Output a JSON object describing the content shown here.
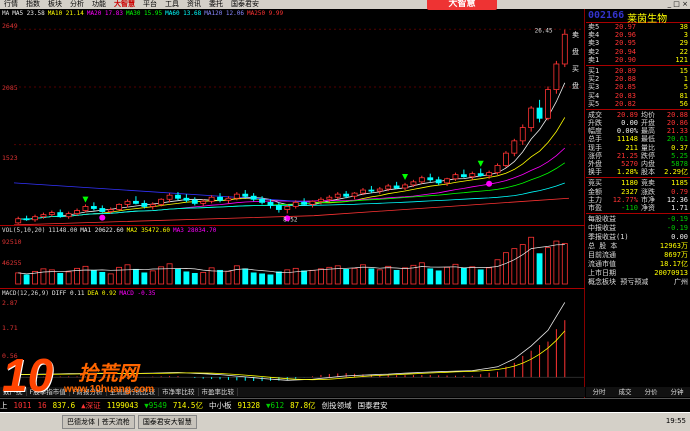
{
  "menu": {
    "items": [
      "行情",
      "指数",
      "板块",
      "分析",
      "功能",
      "大智慧",
      "平台",
      "工具",
      "资讯",
      "委托",
      "国泰君安"
    ],
    "logo": "大智慧"
  },
  "stock": {
    "code": "002166",
    "name": "莱茵生物"
  },
  "main_chart": {
    "legend": [
      {
        "text": "MA",
        "color": "#ddd"
      },
      {
        "text": "MA5 23.58",
        "color": "#eee"
      },
      {
        "text": "MA10 21.14",
        "color": "#ff0"
      },
      {
        "text": "MA20 17.83",
        "color": "#f0f"
      },
      {
        "text": "MA30 15.95",
        "color": "#0f0"
      },
      {
        "text": "MA60 13.68",
        "color": "#0ff"
      },
      {
        "text": "MA120 12.06",
        "color": "#88f"
      },
      {
        "text": "MA250 9.99",
        "color": "#f33"
      }
    ],
    "y_ticks": [
      "2649",
      "2085",
      "1523"
    ],
    "low_label": "8.52",
    "high_label": "26.45"
  },
  "volume_chart": {
    "legend": [
      {
        "text": "VOL(5,10,20)",
        "color": "#ddd"
      },
      {
        "text": "11148.00",
        "color": "#ddd"
      },
      {
        "text": "MA1 20622.60",
        "color": "#eee"
      },
      {
        "text": "MA2 35472.60",
        "color": "#ff0"
      },
      {
        "text": "MA3 28034.70",
        "color": "#f0f"
      }
    ],
    "y_ticks": [
      "92510",
      "46255"
    ]
  },
  "macd_chart": {
    "legend": [
      {
        "text": "MACD(12,26,9)",
        "color": "#ddd"
      },
      {
        "text": "DIFF 0.11",
        "color": "#eee"
      },
      {
        "text": "DEA 0.92",
        "color": "#ff0"
      },
      {
        "text": "MACD -0.35",
        "color": "#f0f"
      }
    ],
    "y_ticks": [
      "2.87",
      "1.71",
      "0.56"
    ]
  },
  "order_book": {
    "asks": [
      {
        "label": "卖5",
        "price": "20.97",
        "vol": "38"
      },
      {
        "label": "卖4",
        "price": "20.96",
        "vol": "3"
      },
      {
        "label": "卖3",
        "price": "20.95",
        "vol": "29"
      },
      {
        "label": "卖2",
        "price": "20.94",
        "vol": "22"
      },
      {
        "label": "卖1",
        "price": "20.90",
        "vol": "121"
      }
    ],
    "bids": [
      {
        "label": "买1",
        "price": "20.89",
        "vol": "15"
      },
      {
        "label": "买2",
        "price": "20.88",
        "vol": "1"
      },
      {
        "label": "买3",
        "price": "20.85",
        "vol": "5"
      },
      {
        "label": "买4",
        "price": "20.83",
        "vol": "81"
      },
      {
        "label": "买5",
        "price": "20.82",
        "vol": "56"
      }
    ]
  },
  "quote": [
    {
      "l": "成交",
      "v": "20.89",
      "vc": "red",
      "l2": "均价",
      "v2": "20.88",
      "v2c": "red"
    },
    {
      "l": "升跌",
      "v": "0.00",
      "vc": "wht",
      "l2": "开盘",
      "v2": "20.86",
      "v2c": "red"
    },
    {
      "l": "幅度",
      "v": "0.00%",
      "vc": "wht",
      "l2": "最高",
      "v2": "21.33",
      "v2c": "red"
    },
    {
      "l": "总手",
      "v": "11148",
      "vc": "yel",
      "l2": "最低",
      "v2": "20.61",
      "v2c": "grn"
    },
    {
      "l": "现手",
      "v": "211",
      "vc": "yel",
      "l2": "量比",
      "v2": "0.37",
      "v2c": "yel"
    },
    {
      "l": "涨停",
      "v": "21.25",
      "vc": "red",
      "l2": "跌停",
      "v2": "5.25",
      "v2c": "grn"
    },
    {
      "l": "外盘",
      "v": "5270",
      "vc": "red",
      "l2": "内盘",
      "v2": "5878",
      "v2c": "grn"
    },
    {
      "l": "换手",
      "v": "1.28%",
      "vc": "yel",
      "l2": "股本",
      "v2": "2.29亿",
      "v2c": "yel"
    }
  ],
  "quote2": [
    {
      "l": "竞买",
      "v": "1180",
      "vc": "yel",
      "l2": "竞卖",
      "v2": "1185",
      "v2c": "yel"
    },
    {
      "l": "金额",
      "v": "2327",
      "vc": "yel",
      "l2": "涨跌",
      "v2": "0.79",
      "v2c": "red"
    },
    {
      "l": "主力",
      "v": "12.77%",
      "vc": "red",
      "l2": "市净",
      "v2": "12.36",
      "v2c": "wht"
    },
    {
      "l": "市盈",
      "v": "-110",
      "vc": "grn",
      "l2": "净资",
      "v2": "1.71",
      "v2c": "wht"
    }
  ],
  "finance": [
    {
      "l": "每股收益",
      "v": "-0.19",
      "c": "grn"
    },
    {
      "l": "中报收益",
      "v": "-0.19",
      "c": "grn"
    },
    {
      "l": "季报收益(1)",
      "v": "0.00",
      "c": "wht"
    },
    {
      "l": "总 股 本",
      "v": "12963万",
      "c": "yel"
    },
    {
      "l": "目前流通",
      "v": "8697万",
      "c": "yel"
    },
    {
      "l": "流通市值",
      "v": "18.17亿",
      "c": "yel"
    },
    {
      "l": "上市日期",
      "v": "20070913",
      "c": "yel"
    },
    {
      "l": "概念板块 预亏预减",
      "v": "广州",
      "c": "wht"
    }
  ],
  "side_tabs": [
    "卖",
    "盘",
    "买",
    "盘"
  ],
  "bottom_tabs": [
    "数户统",
    "F股季指市值",
    "F财报分析",
    "全流通行统比较",
    "市净率比较",
    "市盈率比较"
  ],
  "right_tabs": [
    "分时",
    "成交",
    "分价",
    "分钟"
  ],
  "ticker": [
    {
      "t": "上",
      "c": "wht"
    },
    {
      "t": "1011",
      "c": "red"
    },
    {
      "t": "16",
      "c": "red"
    },
    {
      "t": "837.6",
      "c": "yel"
    },
    {
      "t": "▲深证",
      "c": "red"
    },
    {
      "t": "1199043",
      "c": "yel"
    },
    {
      "t": "▼9549",
      "c": "grn"
    },
    {
      "t": "714.5亿",
      "c": "yel"
    },
    {
      "t": "中小板",
      "c": "wht"
    },
    {
      "t": "91328",
      "c": "yel"
    },
    {
      "t": "▼612",
      "c": "grn"
    },
    {
      "t": "87.8亿",
      "c": "yel"
    },
    {
      "t": "创投领域",
      "c": "wht"
    },
    {
      "t": "国泰君安",
      "c": "wht"
    }
  ],
  "taskbar": {
    "items": [
      "巴德龙体 | 苍天流枪",
      "国泰君安大智慧"
    ],
    "clock": "19:55"
  },
  "watermark": {
    "number": "10",
    "text": "拾荒网",
    "url": "www.10huang.com"
  },
  "candles": [
    [
      1,
      7.6,
      8.2,
      7.5,
      8.0
    ],
    [
      2,
      8.0,
      8.3,
      7.8,
      7.9
    ],
    [
      3,
      7.9,
      8.4,
      7.7,
      8.2
    ],
    [
      4,
      8.2,
      8.6,
      8.0,
      8.4
    ],
    [
      5,
      8.4,
      8.8,
      8.2,
      8.6
    ],
    [
      6,
      8.6,
      8.9,
      8.1,
      8.2
    ],
    [
      7,
      8.2,
      8.7,
      8.0,
      8.5
    ],
    [
      8,
      8.5,
      9.0,
      8.3,
      8.8
    ],
    [
      9,
      8.8,
      9.4,
      8.6,
      9.2
    ],
    [
      10,
      9.2,
      9.6,
      8.8,
      9.0
    ],
    [
      11,
      9.0,
      9.3,
      8.6,
      8.7
    ],
    [
      12,
      8.7,
      9.1,
      8.5,
      8.9
    ],
    [
      13,
      8.9,
      9.5,
      8.8,
      9.4
    ],
    [
      14,
      9.4,
      9.9,
      9.1,
      9.7
    ],
    [
      15,
      9.7,
      10.2,
      9.4,
      9.5
    ],
    [
      16,
      9.5,
      9.8,
      9.0,
      9.2
    ],
    [
      17,
      9.2,
      9.6,
      8.9,
      9.4
    ],
    [
      18,
      9.4,
      10.0,
      9.2,
      9.9
    ],
    [
      19,
      9.9,
      10.5,
      9.6,
      10.3
    ],
    [
      20,
      10.3,
      10.6,
      9.8,
      10.0
    ],
    [
      21,
      10.0,
      10.4,
      9.6,
      9.8
    ],
    [
      22,
      9.8,
      10.1,
      9.3,
      9.5
    ],
    [
      23,
      9.5,
      9.9,
      9.2,
      9.7
    ],
    [
      24,
      9.7,
      10.3,
      9.5,
      10.1
    ],
    [
      25,
      10.1,
      10.5,
      9.6,
      9.8
    ],
    [
      26,
      9.8,
      10.2,
      9.5,
      10.0
    ],
    [
      27,
      10.0,
      10.6,
      9.8,
      10.4
    ],
    [
      28,
      10.4,
      10.8,
      10.0,
      10.2
    ],
    [
      29,
      10.2,
      10.5,
      9.7,
      9.9
    ],
    [
      30,
      9.9,
      10.2,
      9.4,
      9.6
    ],
    [
      31,
      9.6,
      9.9,
      9.0,
      9.3
    ],
    [
      32,
      9.3,
      9.6,
      8.6,
      8.9
    ],
    [
      33,
      8.9,
      9.4,
      8.52,
      9.2
    ],
    [
      34,
      9.2,
      9.8,
      9.0,
      9.6
    ],
    [
      35,
      9.6,
      10.0,
      9.3,
      9.4
    ],
    [
      36,
      9.4,
      9.8,
      9.1,
      9.7
    ],
    [
      37,
      9.7,
      10.1,
      9.4,
      9.9
    ],
    [
      38,
      9.9,
      10.3,
      9.6,
      10.1
    ],
    [
      39,
      10.1,
      10.6,
      9.9,
      10.4
    ],
    [
      40,
      10.4,
      10.7,
      10.0,
      10.2
    ],
    [
      41,
      10.2,
      10.6,
      9.9,
      10.5
    ],
    [
      42,
      10.5,
      11.0,
      10.3,
      10.8
    ],
    [
      43,
      10.8,
      11.2,
      10.5,
      10.7
    ],
    [
      44,
      10.7,
      11.1,
      10.4,
      10.9
    ],
    [
      45,
      10.9,
      11.4,
      10.7,
      11.2
    ],
    [
      46,
      11.2,
      11.6,
      10.9,
      11.0
    ],
    [
      47,
      11.0,
      11.5,
      10.8,
      11.3
    ],
    [
      48,
      11.3,
      11.8,
      11.1,
      11.6
    ],
    [
      49,
      11.6,
      12.2,
      11.4,
      12.0
    ],
    [
      50,
      12.0,
      12.4,
      11.6,
      11.8
    ],
    [
      51,
      11.8,
      12.1,
      11.3,
      11.5
    ],
    [
      52,
      11.5,
      12.0,
      11.2,
      11.9
    ],
    [
      53,
      11.9,
      12.5,
      11.7,
      12.3
    ],
    [
      54,
      12.3,
      12.8,
      12.0,
      12.1
    ],
    [
      55,
      12.1,
      12.6,
      11.8,
      12.4
    ],
    [
      56,
      12.4,
      12.9,
      12.1,
      12.2
    ],
    [
      57,
      12.2,
      12.7,
      11.9,
      12.5
    ],
    [
      58,
      12.5,
      13.4,
      12.3,
      13.2
    ],
    [
      59,
      13.2,
      14.6,
      13.0,
      14.4
    ],
    [
      60,
      14.4,
      15.8,
      14.1,
      15.6
    ],
    [
      61,
      15.6,
      17.2,
      15.2,
      16.9
    ],
    [
      62,
      16.9,
      19.0,
      16.5,
      18.8
    ],
    [
      63,
      18.8,
      19.6,
      17.4,
      17.8
    ],
    [
      64,
      17.8,
      20.9,
      17.6,
      20.6
    ],
    [
      65,
      20.6,
      23.4,
      20.2,
      23.1
    ],
    [
      66,
      23.1,
      26.45,
      22.8,
      26.0
    ]
  ],
  "volumes": [
    [
      1,
      22000
    ],
    [
      2,
      18000
    ],
    [
      3,
      25000
    ],
    [
      4,
      30000
    ],
    [
      5,
      28000
    ],
    [
      6,
      21000
    ],
    [
      7,
      24000
    ],
    [
      8,
      31000
    ],
    [
      9,
      35000
    ],
    [
      10,
      27000
    ],
    [
      11,
      23000
    ],
    [
      12,
      20000
    ],
    [
      13,
      33000
    ],
    [
      14,
      38000
    ],
    [
      15,
      29000
    ],
    [
      16,
      22000
    ],
    [
      17,
      26000
    ],
    [
      18,
      34000
    ],
    [
      19,
      40000
    ],
    [
      20,
      30000
    ],
    [
      21,
      24000
    ],
    [
      22,
      21000
    ],
    [
      23,
      23000
    ],
    [
      24,
      32000
    ],
    [
      25,
      27000
    ],
    [
      26,
      25000
    ],
    [
      27,
      36000
    ],
    [
      28,
      30000
    ],
    [
      29,
      22000
    ],
    [
      30,
      20000
    ],
    [
      31,
      18000
    ],
    [
      32,
      24000
    ],
    [
      33,
      28000
    ],
    [
      34,
      31000
    ],
    [
      35,
      26000
    ],
    [
      36,
      27000
    ],
    [
      37,
      30000
    ],
    [
      38,
      33000
    ],
    [
      39,
      36000
    ],
    [
      40,
      29000
    ],
    [
      41,
      31000
    ],
    [
      42,
      38000
    ],
    [
      43,
      30000
    ],
    [
      44,
      28000
    ],
    [
      45,
      35000
    ],
    [
      46,
      27000
    ],
    [
      47,
      32000
    ],
    [
      48,
      37000
    ],
    [
      49,
      42000
    ],
    [
      50,
      30000
    ],
    [
      51,
      26000
    ],
    [
      52,
      33000
    ],
    [
      53,
      39000
    ],
    [
      54,
      31000
    ],
    [
      55,
      34000
    ],
    [
      56,
      28000
    ],
    [
      57,
      32000
    ],
    [
      58,
      48000
    ],
    [
      59,
      62000
    ],
    [
      60,
      70000
    ],
    [
      61,
      78000
    ],
    [
      62,
      92510
    ],
    [
      63,
      60000
    ],
    [
      64,
      72000
    ],
    [
      65,
      85000
    ],
    [
      66,
      80000
    ]
  ],
  "macd": [
    [
      1,
      0.1
    ],
    [
      5,
      0.12
    ],
    [
      10,
      0.15
    ],
    [
      15,
      0.14
    ],
    [
      20,
      0.18
    ],
    [
      25,
      0.1
    ],
    [
      30,
      -0.05
    ],
    [
      33,
      -0.12
    ],
    [
      36,
      -0.08
    ],
    [
      40,
      0.05
    ],
    [
      45,
      0.12
    ],
    [
      50,
      0.2
    ],
    [
      55,
      0.25
    ],
    [
      58,
      0.4
    ],
    [
      60,
      0.7
    ],
    [
      62,
      1.2
    ],
    [
      64,
      1.8
    ],
    [
      66,
      2.87
    ]
  ]
}
